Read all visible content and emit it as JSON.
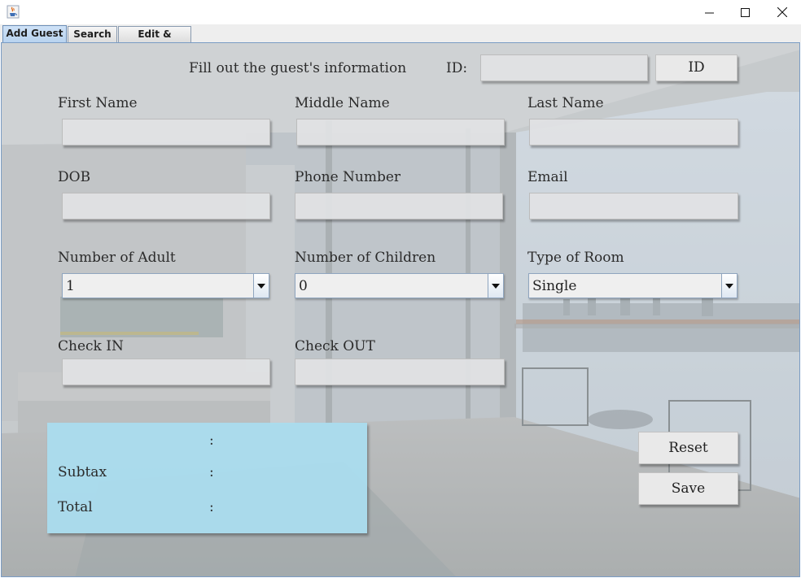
{
  "window": {
    "app_icon": "java-cup-icon",
    "controls": [
      "minimize-icon",
      "maximize-icon",
      "close-icon"
    ]
  },
  "tabs": [
    {
      "label": "Add Guest",
      "active": true
    },
    {
      "label": "Search",
      "active": false
    },
    {
      "label": "Edit & Delete",
      "active": false
    }
  ],
  "form": {
    "heading": "Fill out the guest's information",
    "id_label": "ID:",
    "id_value": "",
    "id_button": "ID",
    "first_name_label": "First Name",
    "first_name_value": "",
    "middle_name_label": "Middle Name",
    "middle_name_value": "",
    "last_name_label": "Last Name",
    "last_name_value": "",
    "dob_label": "DOB",
    "dob_value": "",
    "phone_label": "Phone Number",
    "phone_value": "",
    "email_label": "Email",
    "email_value": "",
    "adults_label": "Number of Adult",
    "adults_value": "1",
    "children_label": "Number of Children",
    "children_value": "0",
    "room_type_label": "Type of Room",
    "room_type_value": "Single",
    "check_in_label": "Check IN",
    "check_in_value": "",
    "check_out_label": "Check OUT",
    "check_out_value": ""
  },
  "summary": {
    "row1_label": "",
    "row1_colon": ":",
    "subtax_label": "Subtax",
    "subtax_colon": ":",
    "total_label": "Total",
    "total_colon": ":"
  },
  "buttons": {
    "reset": "Reset",
    "save": "Save"
  },
  "colors": {
    "summary_bg": "#aadcee",
    "tab_active": "#b8d3ef",
    "panel_border": "#7a9cc4"
  }
}
